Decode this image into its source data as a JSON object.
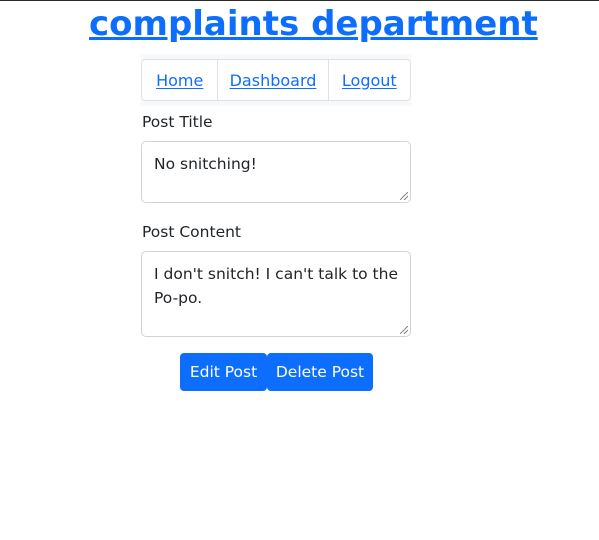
{
  "header": {
    "title": "complaints department"
  },
  "nav": {
    "items": [
      {
        "label": "Home"
      },
      {
        "label": "Dashboard"
      },
      {
        "label": "Logout"
      }
    ]
  },
  "form": {
    "title_label": "Post Title",
    "title_value": "No snitching!",
    "content_label": "Post Content",
    "content_value": "I don't snitch! I can't talk to the Po-po."
  },
  "actions": {
    "edit_label": "Edit Post",
    "delete_label": "Delete Post"
  },
  "colors": {
    "primary": "#0d6efd",
    "border": "#ced4da",
    "text": "#212529"
  }
}
